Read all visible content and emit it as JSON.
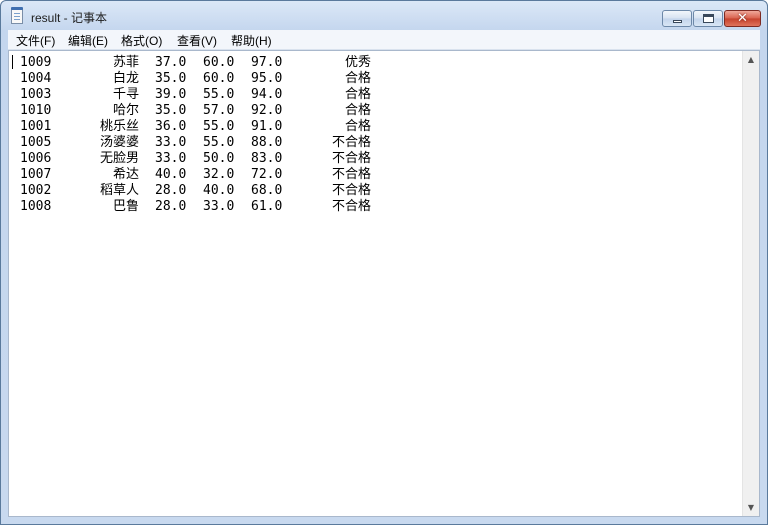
{
  "window": {
    "title": "result - 记事本"
  },
  "menu": [
    {
      "label": "文件(F)"
    },
    {
      "label": "编辑(E)"
    },
    {
      "label": "格式(O)"
    },
    {
      "label": "查看(V)"
    },
    {
      "label": "帮助(H)"
    }
  ],
  "rows": [
    {
      "id": "1009",
      "name": "苏菲",
      "s1": "37.0",
      "s2": "60.0",
      "s3": "97.0",
      "grade": "优秀"
    },
    {
      "id": "1004",
      "name": "白龙",
      "s1": "35.0",
      "s2": "60.0",
      "s3": "95.0",
      "grade": "合格"
    },
    {
      "id": "1003",
      "name": "千寻",
      "s1": "39.0",
      "s2": "55.0",
      "s3": "94.0",
      "grade": "合格"
    },
    {
      "id": "1010",
      "name": "哈尔",
      "s1": "35.0",
      "s2": "57.0",
      "s3": "92.0",
      "grade": "合格"
    },
    {
      "id": "1001",
      "name": "桃乐丝",
      "s1": "36.0",
      "s2": "55.0",
      "s3": "91.0",
      "grade": "合格"
    },
    {
      "id": "1005",
      "name": "汤婆婆",
      "s1": "33.0",
      "s2": "55.0",
      "s3": "88.0",
      "grade": "不合格"
    },
    {
      "id": "1006",
      "name": "无脸男",
      "s1": "33.0",
      "s2": "50.0",
      "s3": "83.0",
      "grade": "不合格"
    },
    {
      "id": "1007",
      "name": "希达",
      "s1": "40.0",
      "s2": "32.0",
      "s3": "72.0",
      "grade": "不合格"
    },
    {
      "id": "1002",
      "name": "稻草人",
      "s1": "28.0",
      "s2": "40.0",
      "s3": "68.0",
      "grade": "不合格"
    },
    {
      "id": "1008",
      "name": "巴鲁",
      "s1": "28.0",
      "s2": "33.0",
      "s3": "61.0",
      "grade": "不合格"
    }
  ],
  "icons": {
    "app": "notepad-icon",
    "minimize": "minimize-icon",
    "maximize": "maximize-icon",
    "close": "close-icon",
    "scroll_up": "scroll-up-icon",
    "scroll_down": "scroll-down-icon"
  }
}
